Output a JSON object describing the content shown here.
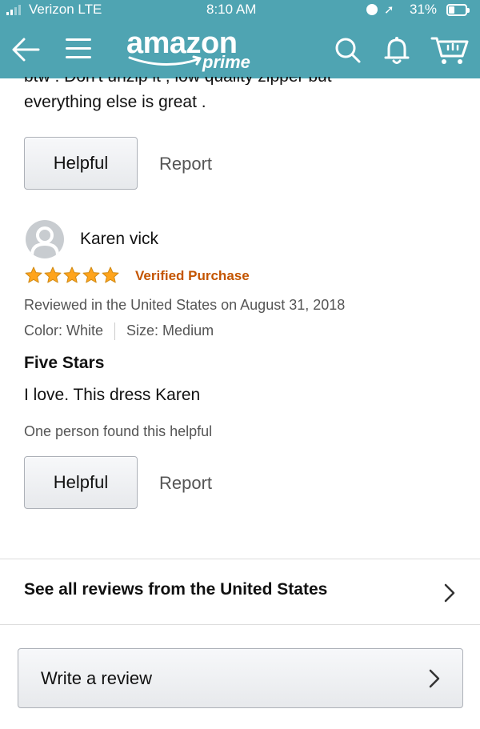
{
  "status_bar": {
    "carrier": "Verizon LTE",
    "time": "8:10 AM",
    "location_glyph": "➚",
    "battery": "31%",
    "battery_level": 0.31
  },
  "header": {
    "logo_word": "amazon",
    "logo_sub": "prime",
    "background_color": "#4fa4b2",
    "icons": [
      "back-arrow-icon",
      "hamburger-menu-icon",
      "search-icon",
      "bell-icon",
      "cart-icon"
    ]
  },
  "previous_review": {
    "clipped_text": "btw : Don't unzip it , low quality zipper but",
    "text_end": "everything else is great ."
  },
  "review": {
    "reviewer_name": "Karen vick",
    "rating": 5,
    "rating_max": 5,
    "star_color": "#ffa41c",
    "verified_label": "Verified Purchase",
    "reviewed_line": "Reviewed in the United States on August 31, 2018",
    "color_label": "Color: White",
    "size_label": "Size: Medium",
    "title": "Five Stars",
    "body": "I love. This dress Karen",
    "helpful_count_text": "One person found this helpful"
  },
  "actions": {
    "helpful_label": "Helpful",
    "report_label": "Report"
  },
  "footer": {
    "see_all_label": "See all reviews from the United States",
    "write_review_label": "Write a review"
  }
}
